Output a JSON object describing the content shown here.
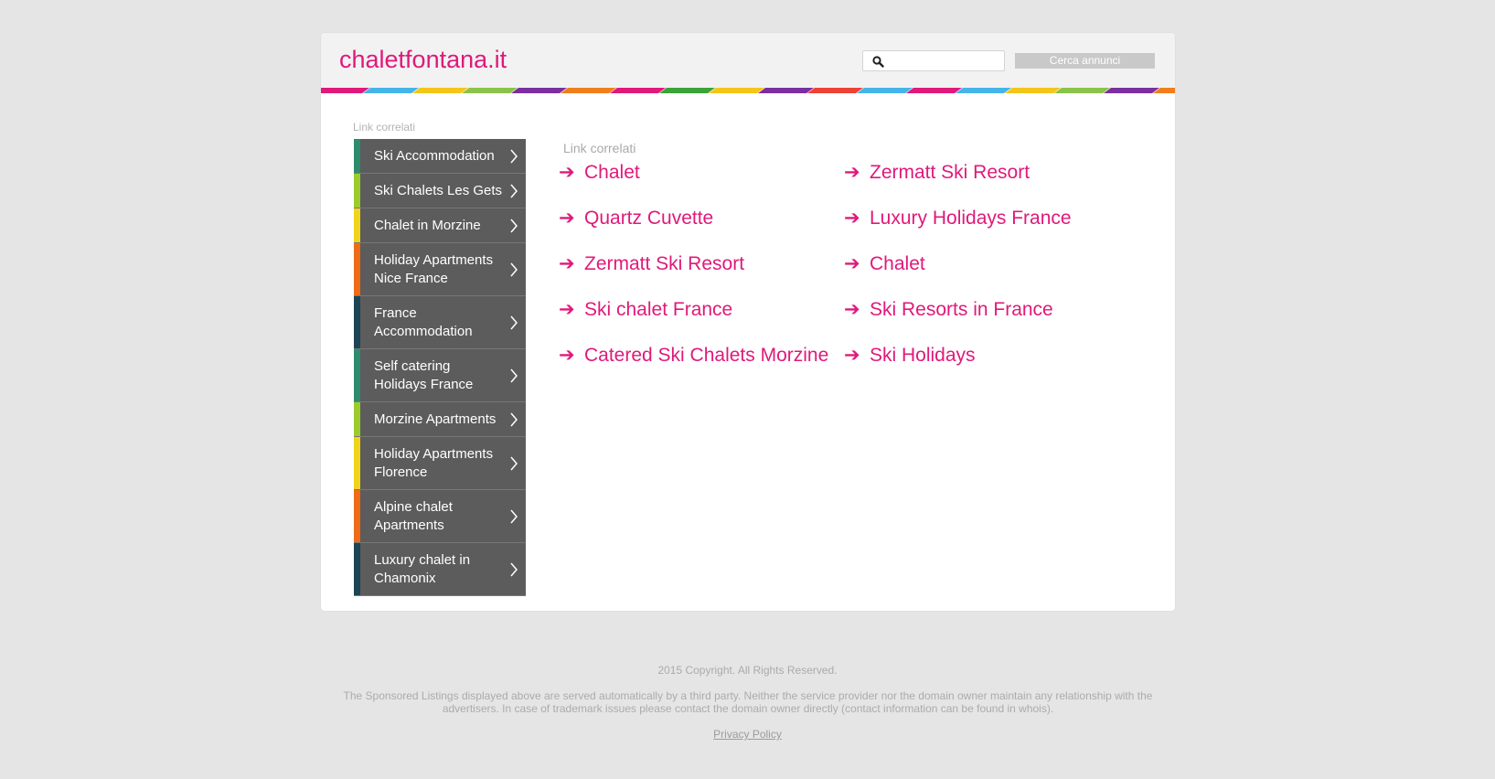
{
  "header": {
    "logo": "chaletfontana.it",
    "search_placeholder": "",
    "search_button": "Cerca annunci"
  },
  "sidebar": {
    "title": "Link correlati",
    "items": [
      {
        "label": "Ski Accommodation",
        "color": "#2e8b6e"
      },
      {
        "label": "Ski Chalets Les Gets",
        "color": "#9ccc2c"
      },
      {
        "label": "Chalet in Morzine",
        "color": "#f0d41a"
      },
      {
        "label": "Holiday Apartments Nice France",
        "color": "#ef6b15"
      },
      {
        "label": "France Accommodation",
        "color": "#1c4455"
      },
      {
        "label": "Self catering Holidays France",
        "color": "#2e8b6e"
      },
      {
        "label": "Morzine Apartments",
        "color": "#9ccc2c"
      },
      {
        "label": "Holiday Apartments Florence",
        "color": "#f0d41a"
      },
      {
        "label": "Alpine chalet Apartments",
        "color": "#ef6b15"
      },
      {
        "label": "Luxury chalet in Chamonix",
        "color": "#1c4455"
      }
    ]
  },
  "content": {
    "title": "Link correlati",
    "arrow": "➔",
    "links": [
      "Chalet",
      "Zermatt Ski Resort",
      "Quartz Cuvette",
      "Luxury Holidays France",
      "Zermatt Ski Resort",
      "Chalet",
      "Ski chalet France",
      "Ski Resorts in France",
      "Catered Ski Chalets Morzine",
      "Ski Holidays"
    ]
  },
  "footer": {
    "copyright": "2015 Copyright. All Rights Reserved.",
    "note": "The Sponsored Listings displayed above are served automatically by a third party. Neither the service provider nor the domain owner maintain any relationship with the advertisers. In case of trademark issues please contact the domain owner directly (contact information can be found in whois).",
    "privacy": "Privacy Policy"
  },
  "colors": {
    "accent": "#e0197a",
    "stripe": [
      "#e0197a",
      "#45b5e8",
      "#f5c518",
      "#8bc34a",
      "#7b2fa0",
      "#f07e1c",
      "#e0197a",
      "#3aa33a",
      "#f5c518",
      "#7b2fa0",
      "#ef4136",
      "#45b5e8"
    ]
  }
}
